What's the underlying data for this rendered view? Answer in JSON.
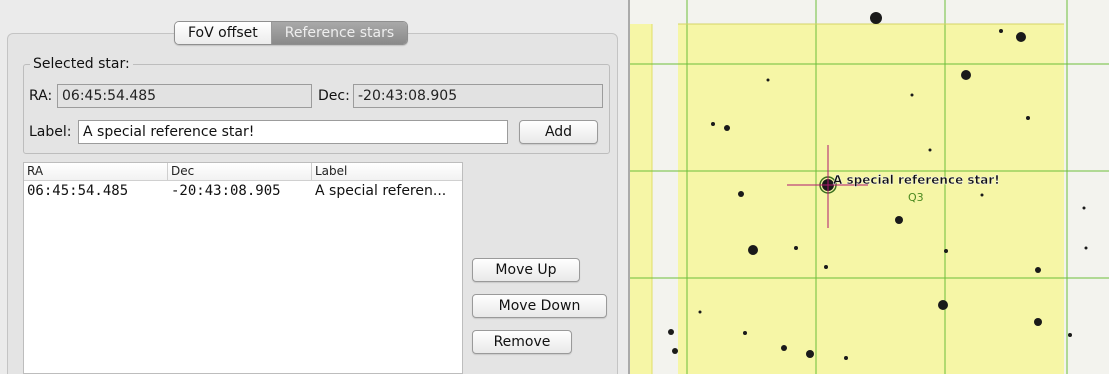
{
  "tabs": [
    {
      "label": "FoV offset",
      "active": false
    },
    {
      "label": "Reference stars",
      "active": true
    }
  ],
  "selected_star": {
    "group_title": "Selected star:",
    "ra_label": "RA:",
    "ra_value": "06:45:54.485",
    "dec_label": "Dec:",
    "dec_value": "-20:43:08.905",
    "label_label": "Label:",
    "label_value": "A special reference star!",
    "add_button": "Add"
  },
  "star_table": {
    "columns": [
      "RA",
      "Dec",
      "Label"
    ],
    "rows": [
      {
        "ra": "06:45:54.485",
        "dec": "-20:43:08.905",
        "label": "A special referen..."
      }
    ]
  },
  "actions": {
    "move_up": "Move Up",
    "move_down": "Move Down",
    "remove": "Remove"
  },
  "sky_view": {
    "star_label": "A special reference star!",
    "target_marker": "Q3",
    "field_color": "#f6f6a6",
    "grid_color": "#6cbf3a",
    "crosshair_color": "#b0186e"
  }
}
